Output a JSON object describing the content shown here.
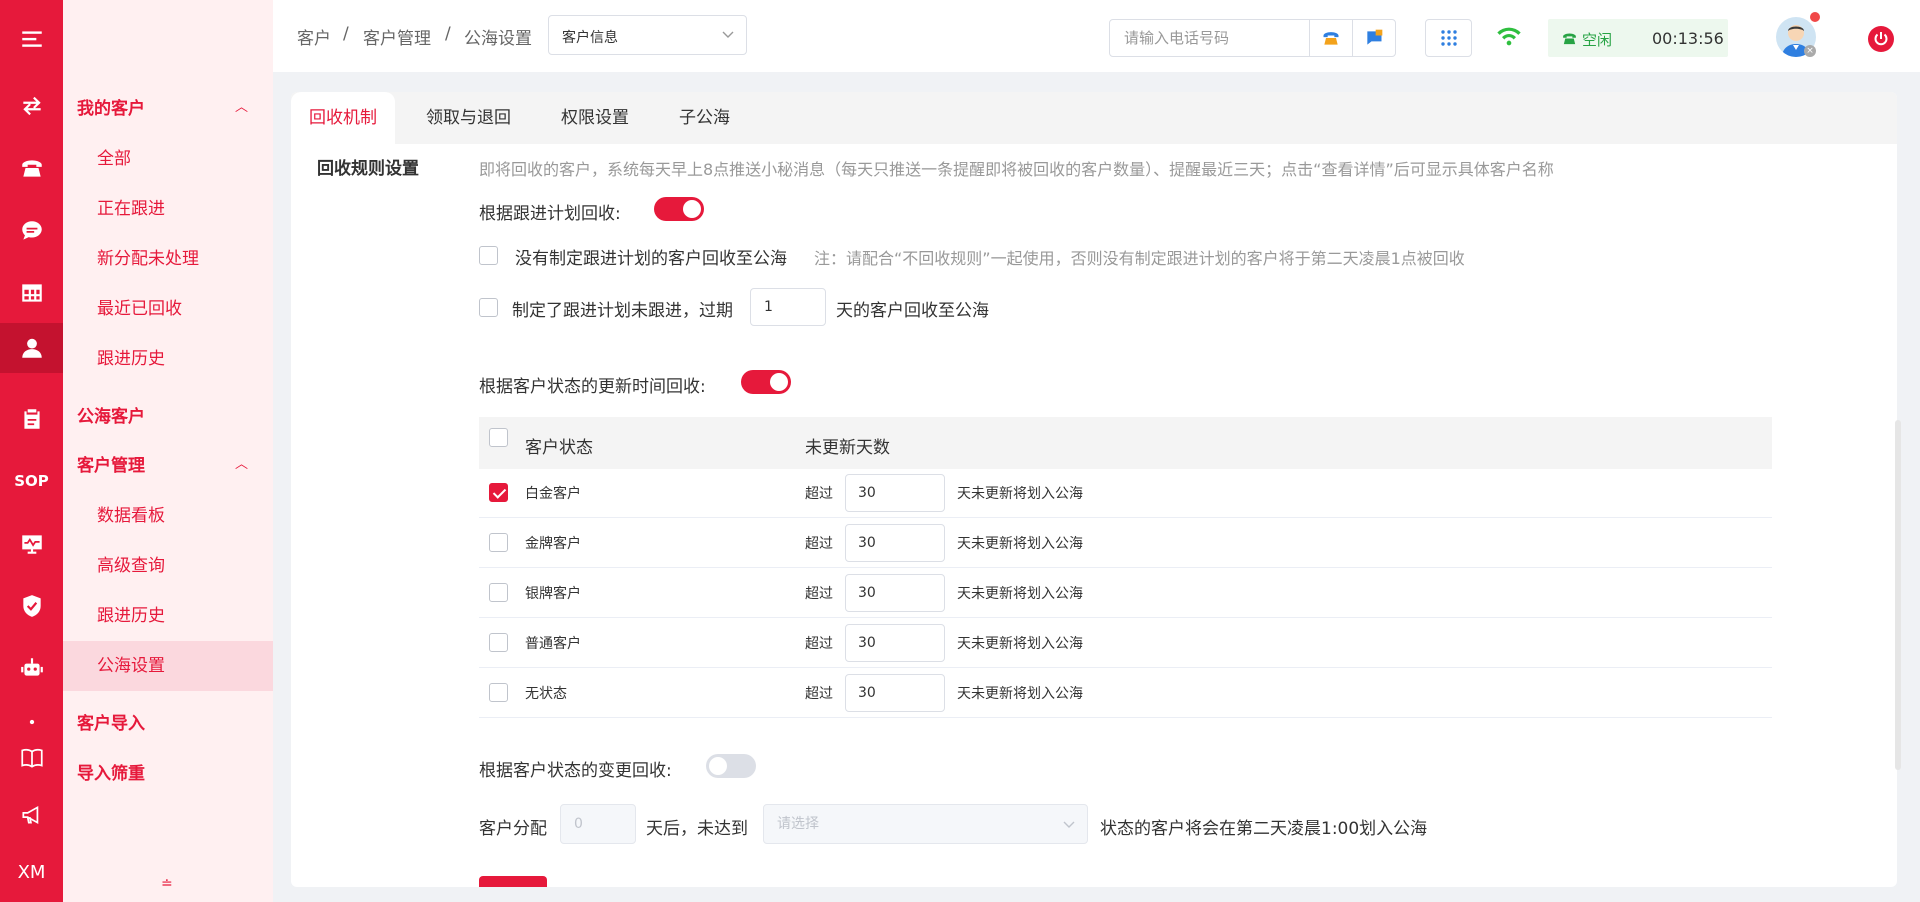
{
  "rail": {
    "active_index": 4,
    "items": [
      {
        "icon": "menu-icon"
      },
      {
        "icon": "transfer-icon"
      },
      {
        "icon": "telephone-icon"
      },
      {
        "icon": "chat-bubble-icon"
      },
      {
        "icon": "table-grid-icon"
      },
      {
        "icon": "user-icon"
      },
      {
        "icon": "clipboard-icon"
      },
      {
        "icon": "sop-label",
        "text": "SOP"
      },
      {
        "icon": "monitor-chart-icon"
      },
      {
        "icon": "shield-check-icon"
      },
      {
        "icon": "robot-icon"
      },
      {
        "icon": "dot-icon"
      },
      {
        "icon": "book-icon"
      },
      {
        "icon": "megaphone-icon"
      },
      {
        "icon": "xm-label",
        "text": "XM"
      }
    ]
  },
  "submenu": {
    "my_customers": "我的客户",
    "my_customers_items": [
      "全部",
      "正在跟进",
      "新分配未处理",
      "最近已回收",
      "跟进历史"
    ],
    "public_pool": "公海客户",
    "customer_management": "客户管理",
    "management_items": [
      "数据看板",
      "高级查询",
      "跟进历史",
      "公海设置"
    ],
    "active_item": "公海设置",
    "customer_import": "客户导入",
    "import_filter": "导入筛重"
  },
  "header": {
    "breadcrumb": [
      "客户",
      "客户管理",
      "公海设置"
    ],
    "breadcrumb_sep": "/",
    "select_value": "客户信息",
    "phone_placeholder": "请输入电话号码",
    "call_state": "空闲",
    "timer": "00:13:56"
  },
  "tabs": [
    "回收机制",
    "领取与退回",
    "权限设置",
    "子公海"
  ],
  "active_tab": "回收机制",
  "rules": {
    "section_title": "回收规则设置",
    "notice": "即将回收的客户，系统每天早上8点推送小秘消息（每天只推送一条提醒即将被回收的客户数量）、提醒最近三天；点击“查看详情”后可显示具体客户名称",
    "by_plan_label": "根据跟进计划回收:",
    "by_plan_enabled": true,
    "no_plan_option": "没有制定跟进计划的客户回收至公海",
    "no_plan_checked": false,
    "no_plan_note": "注：请配合“不回收规则”一起使用，否则没有制定跟进计划的客户将于第二天凌晨1点被回收",
    "overdue_prefix": "制定了跟进计划未跟进，过期",
    "overdue_days": "1",
    "overdue_suffix": "天的客户回收至公海",
    "overdue_checked": false,
    "by_update_label": "根据客户状态的更新时间回收:",
    "by_update_enabled": true,
    "table": {
      "col_status": "客户状态",
      "col_days": "未更新天数",
      "over_label": "超过",
      "suffix": "天未更新将划入公海",
      "rows": [
        {
          "name": "白金客户",
          "days": "30",
          "checked": true
        },
        {
          "name": "金牌客户",
          "days": "30",
          "checked": false
        },
        {
          "name": "银牌客户",
          "days": "30",
          "checked": false
        },
        {
          "name": "普通客户",
          "days": "30",
          "checked": false
        },
        {
          "name": "无状态",
          "days": "30",
          "checked": false
        }
      ]
    },
    "by_change_label": "根据客户状态的变更回收:",
    "by_change_enabled": false,
    "assign_prefix": "客户分配",
    "assign_days": "0",
    "assign_middle": "天后，未达到",
    "assign_select_placeholder": "请选择",
    "assign_suffix": "状态的客户将会在第二天凌晨1:00划入公海"
  },
  "colors": {
    "brand": "#e6193b",
    "submenu_bg": "#fff0f1",
    "status_green": "#27a344"
  }
}
